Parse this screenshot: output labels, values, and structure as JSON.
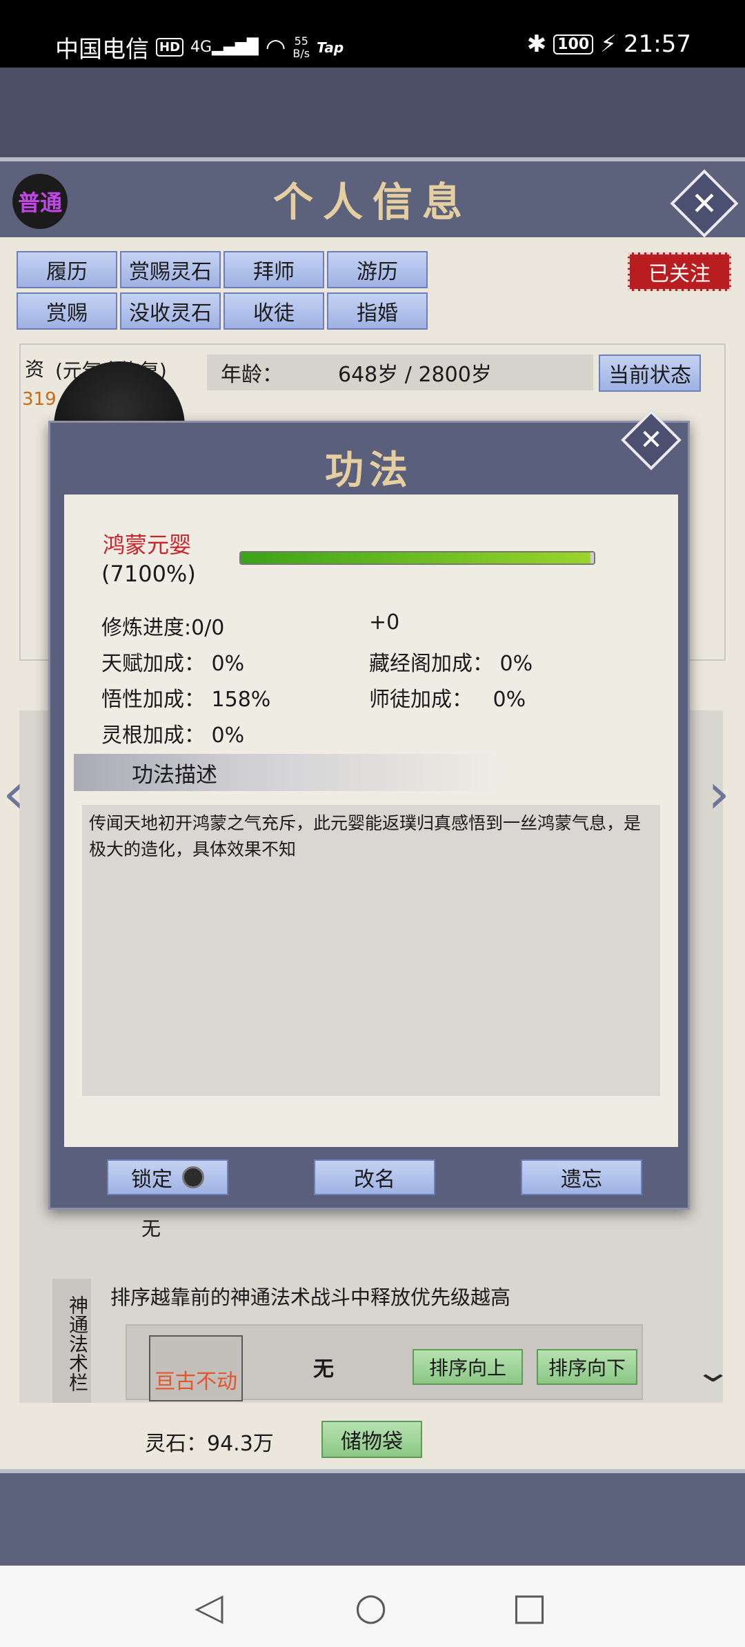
{
  "status_bar": {
    "carrier": "中国电信",
    "hd": "HD",
    "network": "4G",
    "speed_value": "55",
    "speed_unit": "B/s",
    "app_tag": "Tap",
    "battery": "100",
    "time": "21:57"
  },
  "header": {
    "title": "个人信息",
    "badge": "普通"
  },
  "actions": {
    "row1": [
      "履历",
      "赏赐灵石",
      "拜师",
      "游历"
    ],
    "row2": [
      "赏赐",
      "没收灵石",
      "收徒",
      "指婚"
    ],
    "followed": "已关注"
  },
  "profile": {
    "resource_label": "资",
    "resource_value": "319",
    "state_note": "(元气未恢复)",
    "age_label": "年龄：",
    "age_value": "648岁 / 2800岁",
    "status_button": "当前状态"
  },
  "modal": {
    "title": "功法",
    "skill_name": "鸿蒙元婴",
    "skill_percent": "(7100%)",
    "progress_fraction": 0.99,
    "stats": {
      "progress_label": "修炼进度:",
      "progress_value": "0/0",
      "plus_value": "+0",
      "talent_label": "天赋加成：",
      "talent_value": "0%",
      "library_label": "藏经阁加成：",
      "library_value": "0%",
      "insight_label": "悟性加成：",
      "insight_value": "158%",
      "mentor_label": "师徒加成：",
      "mentor_value": "0%",
      "root_label": "灵根加成：",
      "root_value": "0%"
    },
    "desc_header": "功法描述",
    "description": "传闻天地初开鸿蒙之气充斥，此元婴能返璞归真感悟到一丝鸿蒙气息，是极大的造化，具体效果不知",
    "buttons": {
      "lock": "锁定",
      "rename": "改名",
      "forget": "遗忘"
    }
  },
  "lower": {
    "none_text": "无",
    "vert_tab": "神通法术栏",
    "sort_tip": "排序越靠前的神通法术战斗中释放优先级越高",
    "skill_name": "亘古不动",
    "skill_slot": "无",
    "sort_up": "排序向上",
    "sort_down": "排序向下",
    "spirit_stone": "灵石：94.3万",
    "storage_button": "储物袋"
  }
}
